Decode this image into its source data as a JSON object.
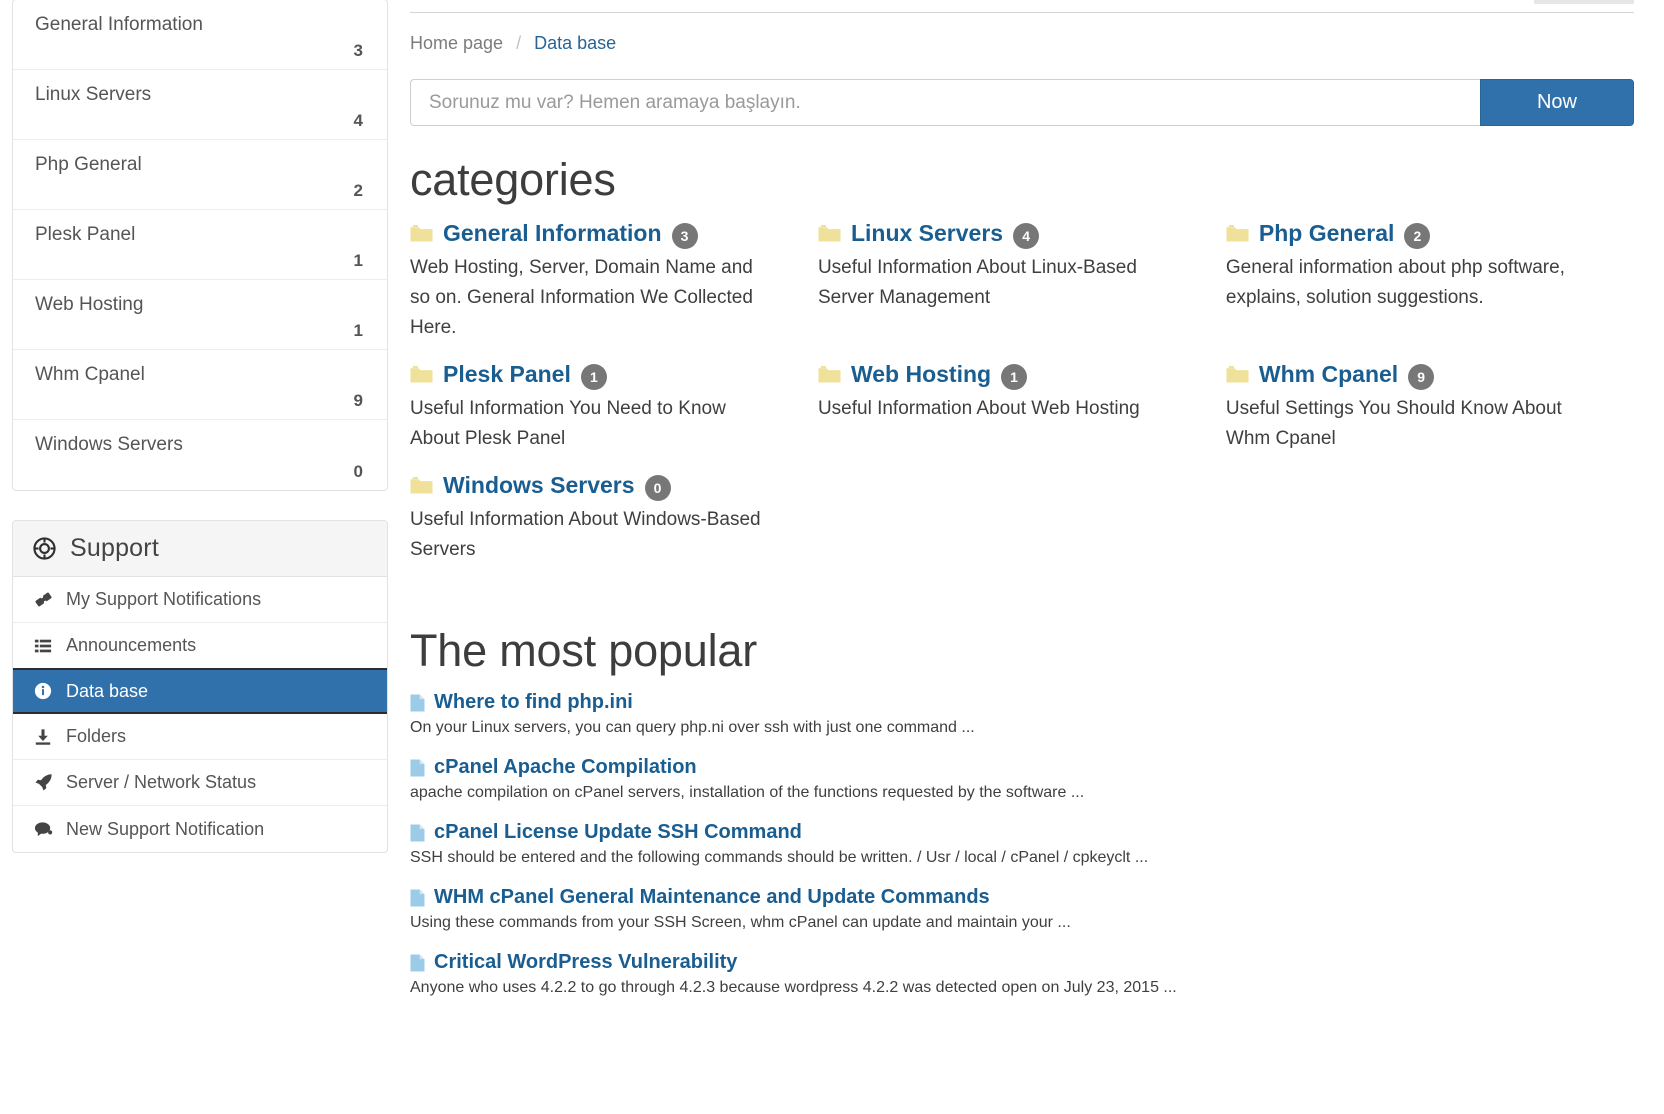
{
  "sidebar": {
    "categories": [
      {
        "label": "General Information",
        "count": "3"
      },
      {
        "label": "Linux Servers",
        "count": "4"
      },
      {
        "label": "Php General",
        "count": "2"
      },
      {
        "label": "Plesk Panel",
        "count": "1"
      },
      {
        "label": "Web Hosting",
        "count": "1"
      },
      {
        "label": "Whm Cpanel",
        "count": "9"
      },
      {
        "label": "Windows Servers",
        "count": "0"
      }
    ],
    "support": {
      "title": "Support",
      "icon": "lifering-icon",
      "items": [
        {
          "label": "My Support Notifications",
          "icon": "ticket-icon",
          "active": false
        },
        {
          "label": "Announcements",
          "icon": "list-icon",
          "active": false
        },
        {
          "label": "Data base",
          "icon": "info-circle-icon",
          "active": true
        },
        {
          "label": "Folders",
          "icon": "download-icon",
          "active": false
        },
        {
          "label": "Server / Network Status",
          "icon": "rocket-icon",
          "active": false
        },
        {
          "label": "New Support Notification",
          "icon": "comment-icon",
          "active": false
        }
      ]
    }
  },
  "breadcrumb": {
    "home": "Home page",
    "separator": "/",
    "current": "Data base"
  },
  "search": {
    "placeholder": "Sorunuz mu var? Hemen aramaya başlayın.",
    "value": "",
    "button_label": "Now"
  },
  "categories_section": {
    "heading": "categories",
    "items": [
      {
        "name": "General Information",
        "count": "3",
        "description": "Web Hosting, Server, Domain Name and so on. General Information We Collected Here."
      },
      {
        "name": "Linux Servers",
        "count": "4",
        "description": "Useful Information About Linux-Based Server Management"
      },
      {
        "name": "Php General",
        "count": "2",
        "description": "General information about php software, explains, solution suggestions."
      },
      {
        "name": "Plesk Panel",
        "count": "1",
        "description": "Useful Information You Need to Know About Plesk Panel"
      },
      {
        "name": "Web Hosting",
        "count": "1",
        "description": "Useful Information About Web Hosting"
      },
      {
        "name": "Whm Cpanel",
        "count": "9",
        "description": "Useful Settings You Should Know About Whm Cpanel"
      },
      {
        "name": "Windows Servers",
        "count": "0",
        "description": "Useful Information About Windows-Based Servers"
      }
    ]
  },
  "popular_section": {
    "heading": "The most popular",
    "items": [
      {
        "title": "Where to find php.ini",
        "excerpt": "On your Linux servers, you can query php.ni over ssh with just one command ..."
      },
      {
        "title": "cPanel Apache Compilation",
        "excerpt": "apache compilation on cPanel servers, installation of the functions requested by the software ..."
      },
      {
        "title": "cPanel License Update SSH Command",
        "excerpt": "SSH should be entered and the following commands should be written. / Usr / local / cPanel / cpkeyclt ..."
      },
      {
        "title": "WHM cPanel General Maintenance and Update Commands",
        "excerpt": "Using these commands from your SSH Screen, whm cPanel can update and maintain your ..."
      },
      {
        "title": "Critical WordPress Vulnerability",
        "excerpt": "Anyone who uses 4.2.2 to go through 4.2.3 because wordpress 4.2.2 was detected open on July 23, 2015 ..."
      }
    ]
  },
  "colors": {
    "accent_blue": "#3071ab",
    "link_blue": "#1a5e91",
    "badge_gray": "#777777",
    "folder_yellow": "#efe19a",
    "doc_blue": "#9ccbe8"
  }
}
